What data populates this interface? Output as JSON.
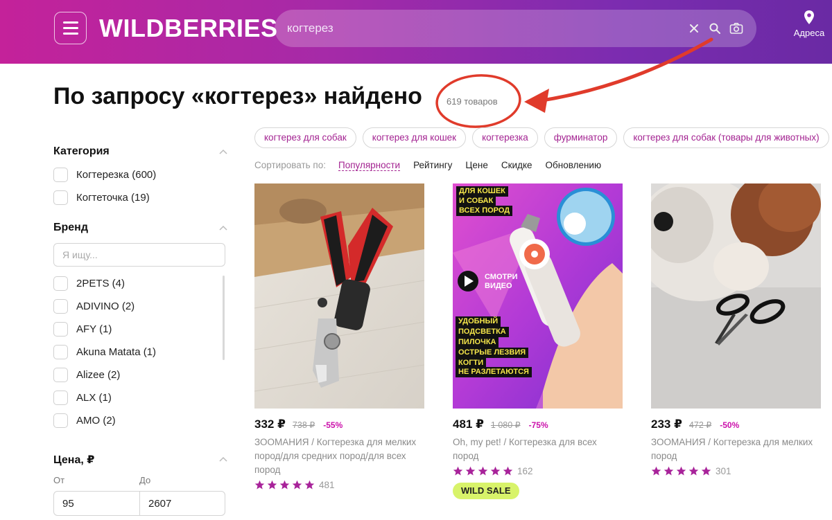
{
  "header": {
    "logo": "WILDBERRIES",
    "search_value": "когтерез",
    "address_label": "Адреса"
  },
  "results": {
    "title": "По запросу «когтерез» найдено",
    "count": "619 товаров"
  },
  "sidebar": {
    "category": {
      "title": "Категория",
      "items": [
        "Когтерезка (600)",
        "Когтеточка (19)"
      ]
    },
    "brand": {
      "title": "Бренд",
      "search_placeholder": "Я ищу...",
      "items": [
        "2PETS (4)",
        "ADIVINO (2)",
        "AFY (1)",
        "Akuna Matata (1)",
        "Alizee (2)",
        "ALX (1)",
        "AMO (2)"
      ]
    },
    "price": {
      "title": "Цена, ₽",
      "from_label": "От",
      "to_label": "До",
      "from_value": "95",
      "to_value": "2607"
    }
  },
  "chips": [
    "когтерез для собак",
    "когтерез для кошек",
    "когтерезка",
    "фурминатор",
    "когтерез для собак (товары для животных)"
  ],
  "sort": {
    "label": "Сортировать по:",
    "options": [
      "Популярности",
      "Рейтингу",
      "Цене",
      "Скидке",
      "Обновлению"
    ],
    "active": "Популярности"
  },
  "products": [
    {
      "price": "332 ₽",
      "old_price": "738 ₽",
      "discount": "-55%",
      "description": "ЗООМАНИЯ / Когтерезка для мелких пород/для средних пород/для всех пород",
      "rating": 5,
      "reviews": "481"
    },
    {
      "price": "481 ₽",
      "old_price": "1 080 ₽",
      "discount": "-75%",
      "description": "Oh, my pet! / Когтерезка для всех пород",
      "rating": 5,
      "reviews": "162",
      "badge": "WILD SALE",
      "promo": {
        "headline": [
          "ДЛЯ КОШЕК",
          "И СОБАК",
          "ВСЕХ ПОРОД"
        ],
        "video": [
          "СМОТРИ",
          "ВИДЕО"
        ],
        "features": [
          "УДОБНЫЙ",
          "ПОДСВЕТКА",
          "ПИЛОЧКА",
          "ОСТРЫЕ ЛЕЗВИЯ",
          "КОГТИ",
          "НЕ РАЗЛЕТАЮТСЯ"
        ]
      }
    },
    {
      "price": "233 ₽",
      "old_price": "472 ₽",
      "discount": "-50%",
      "description": "ЗООМАНИЯ / Когтерезка для мелких пород",
      "rating": 5,
      "reviews": "301"
    }
  ],
  "colors": {
    "brand_gradient_start": "#c4229a",
    "brand_gradient_end": "#6a2aa4",
    "accent": "#a32391",
    "discount": "#cb11ab",
    "star": "#a8239a",
    "annotation": "#e03b2b",
    "wild_sale_bg": "#d8f36a"
  }
}
